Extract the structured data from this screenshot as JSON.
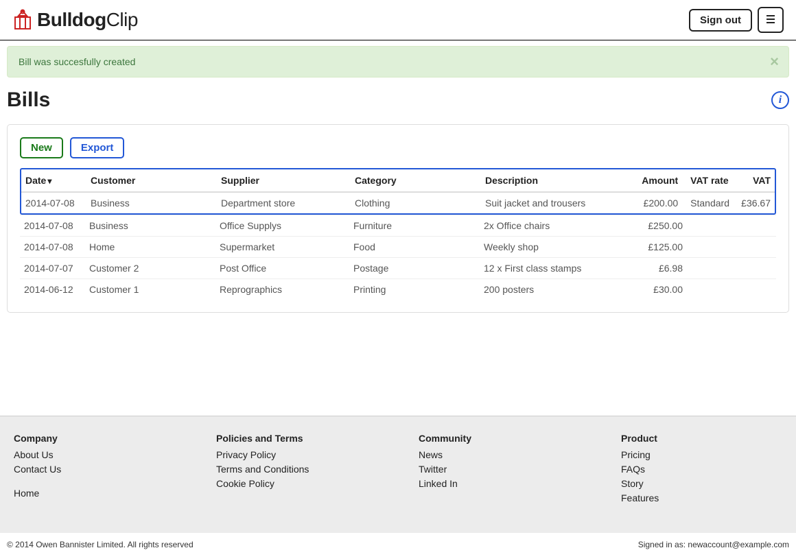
{
  "header": {
    "logo_bold": "Bulldog",
    "logo_light": "Clip",
    "signout": "Sign out"
  },
  "alert": {
    "message": "Bill was succesfully created"
  },
  "page": {
    "title": "Bills"
  },
  "actions": {
    "new": "New",
    "export": "Export"
  },
  "table": {
    "headers": {
      "date": "Date",
      "customer": "Customer",
      "supplier": "Supplier",
      "category": "Category",
      "description": "Description",
      "amount": "Amount",
      "vat_rate": "VAT rate",
      "vat": "VAT"
    },
    "rows": [
      {
        "date": "2014-07-08",
        "customer": "Business",
        "supplier": "Department store",
        "category": "Clothing",
        "description": "Suit jacket and trousers",
        "amount": "£200.00",
        "vat_rate": "Standard",
        "vat": "£36.67"
      },
      {
        "date": "2014-07-08",
        "customer": "Business",
        "supplier": "Office Supplys",
        "category": "Furniture",
        "description": "2x Office chairs",
        "amount": "£250.00",
        "vat_rate": "",
        "vat": ""
      },
      {
        "date": "2014-07-08",
        "customer": "Home",
        "supplier": "Supermarket",
        "category": "Food",
        "description": "Weekly shop",
        "amount": "£125.00",
        "vat_rate": "",
        "vat": ""
      },
      {
        "date": "2014-07-07",
        "customer": "Customer 2",
        "supplier": "Post Office",
        "category": "Postage",
        "description": "12 x First class stamps",
        "amount": "£6.98",
        "vat_rate": "",
        "vat": ""
      },
      {
        "date": "2014-06-12",
        "customer": "Customer 1",
        "supplier": "Reprographics",
        "category": "Printing",
        "description": "200 posters",
        "amount": "£30.00",
        "vat_rate": "",
        "vat": ""
      }
    ]
  },
  "footer": {
    "company": {
      "title": "Company",
      "links": [
        "About Us",
        "Contact Us"
      ],
      "home": "Home"
    },
    "policies": {
      "title": "Policies and Terms",
      "links": [
        "Privacy Policy",
        "Terms and Conditions",
        "Cookie Policy"
      ]
    },
    "community": {
      "title": "Community",
      "links": [
        "News",
        "Twitter",
        "Linked In"
      ]
    },
    "product": {
      "title": "Product",
      "links": [
        "Pricing",
        "FAQs",
        "Story",
        "Features"
      ]
    }
  },
  "footer_bottom": {
    "copyright": "© 2014 Owen Bannister Limited. All rights reserved",
    "signed_in": "Signed in as: newaccount@example.com"
  }
}
